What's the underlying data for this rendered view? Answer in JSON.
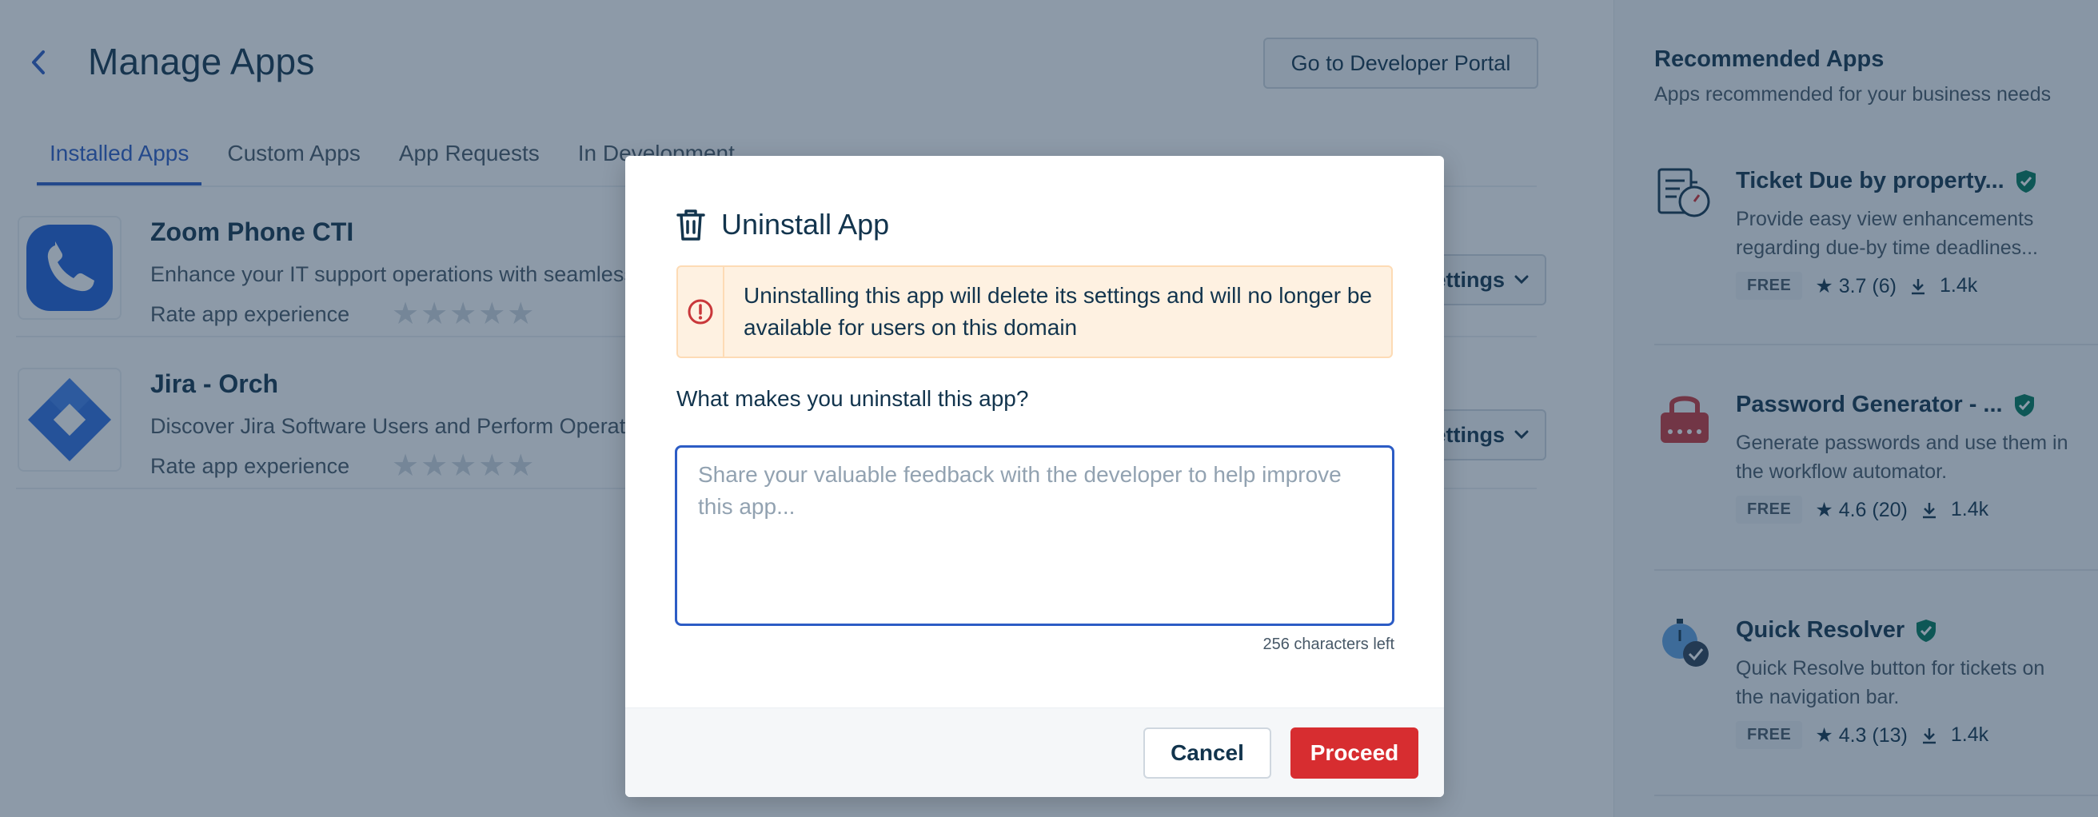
{
  "header": {
    "title": "Manage Apps",
    "back_icon": "chevron-left-icon",
    "dev_portal_label": "Go to Developer Portal"
  },
  "tabs": [
    {
      "label": "Installed Apps",
      "active": true
    },
    {
      "label": "Custom Apps",
      "active": false
    },
    {
      "label": "App Requests",
      "active": false
    },
    {
      "label": "In Development",
      "active": false
    }
  ],
  "installed_apps": [
    {
      "name": "Zoom Phone CTI",
      "description": "Enhance your IT support operations with seamless",
      "rate_label": "Rate app experience",
      "stars": "★★★★★",
      "settings_label": "Settings",
      "icon": "phone-icon"
    },
    {
      "name": "Jira - Orch",
      "description": "Discover Jira Software Users and Perform Operations",
      "rate_label": "Rate app experience",
      "stars": "★★★★★",
      "settings_label": "Settings",
      "icon": "jira-icon"
    }
  ],
  "recommended": {
    "title": "Recommended Apps",
    "subtitle": "Apps recommended for your business needs",
    "items": [
      {
        "name": "Ticket Due by property...",
        "description": "Provide easy view enhancements regarding due-by time deadlines...",
        "badge": "FREE",
        "rating": "★ 3.7 (6)",
        "downloads": "1.4k",
        "icon": "ticket-due-icon"
      },
      {
        "name": "Password Generator - ...",
        "description": "Generate passwords and use them in the workflow automator.",
        "badge": "FREE",
        "rating": "★ 4.6 (20)",
        "downloads": "1.4k",
        "icon": "padlock-icon"
      },
      {
        "name": "Quick Resolver",
        "description": "Quick Resolve button for tickets on the navigation bar.",
        "badge": "FREE",
        "rating": "★ 4.3 (13)",
        "downloads": "1.4k",
        "icon": "stopwatch-check-icon"
      }
    ]
  },
  "modal": {
    "title": "Uninstall App",
    "warning": "Uninstalling this app will delete its settings and will no longer be available for users on this domain",
    "question": "What makes you uninstall this app?",
    "feedback_value": "",
    "feedback_placeholder": "Share your valuable feedback with the developer to help improve this app...",
    "char_count": "256 characters left",
    "cancel_label": "Cancel",
    "proceed_label": "Proceed"
  },
  "colors": {
    "primary": "#2c5cc5",
    "danger": "#d72d30",
    "warning_bg": "#fef1e1",
    "verified": "#00795b"
  }
}
